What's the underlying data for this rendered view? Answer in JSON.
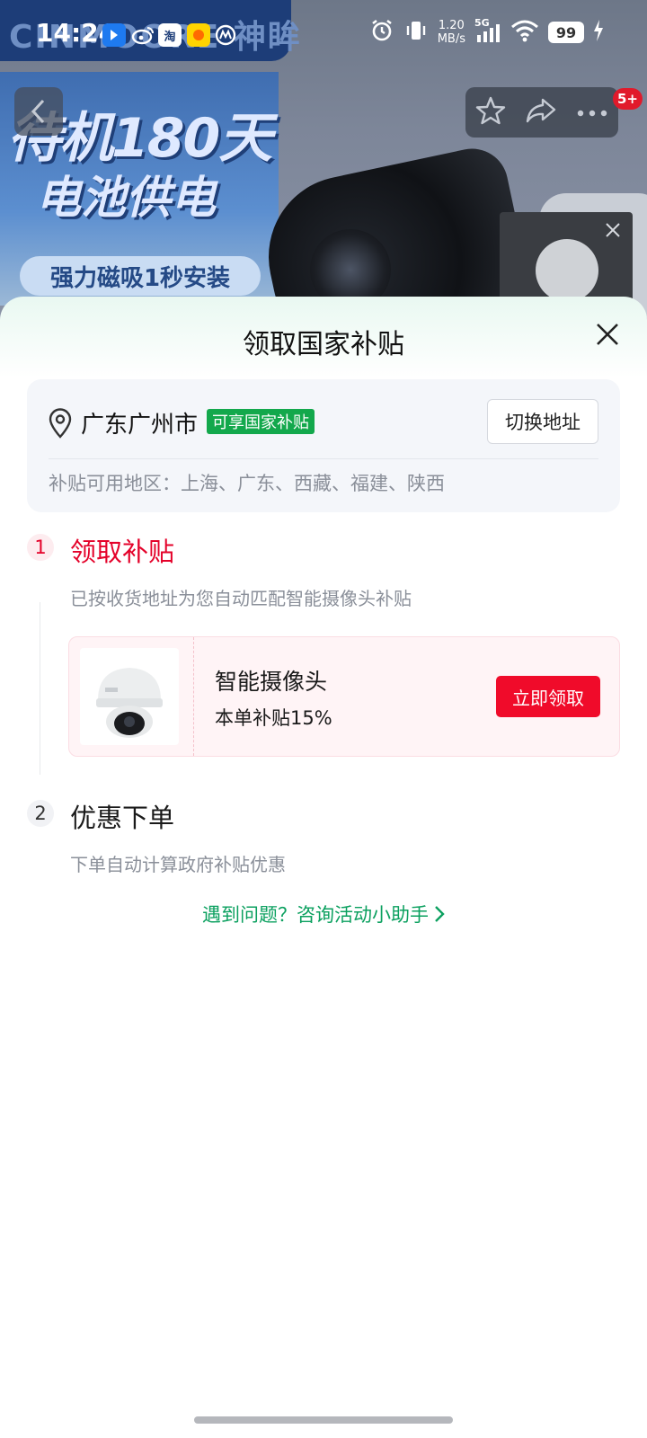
{
  "status_bar": {
    "time": "14:24",
    "net_speed_value": "1.20",
    "net_speed_unit": "MB/s",
    "network": "5G",
    "battery": "99",
    "app_icons": [
      "taobao",
      "淘",
      "weibo",
      "maps",
      "game"
    ],
    "brand_watermark": "CINMOORE 神眸"
  },
  "background": {
    "promo_line1": "待机180天",
    "promo_line2": "电池供电",
    "promo_pill": "强力磁吸1秒安装",
    "notification_badge": "5+"
  },
  "sheet": {
    "title": "领取国家补贴",
    "address": {
      "city": "广东广州市",
      "tag": "可享国家补贴",
      "switch_label": "切换地址",
      "regions": "补贴可用地区：上海、广东、西藏、福建、陕西"
    },
    "step1": {
      "number": "1",
      "title": "领取补贴",
      "desc": "已按收货地址为您自动匹配智能摄像头补贴",
      "card": {
        "product_name": "智能摄像头",
        "subsidy": "本单补贴15%",
        "claim_label": "立即领取"
      }
    },
    "step2": {
      "number": "2",
      "title": "优惠下单",
      "desc": "下单自动计算政府补贴优惠"
    },
    "help_link": "遇到问题？咨询活动小助手"
  },
  "colors": {
    "accent_red": "#f00b2a",
    "accent_green": "#13a84c",
    "link_green": "#0ba05f"
  }
}
